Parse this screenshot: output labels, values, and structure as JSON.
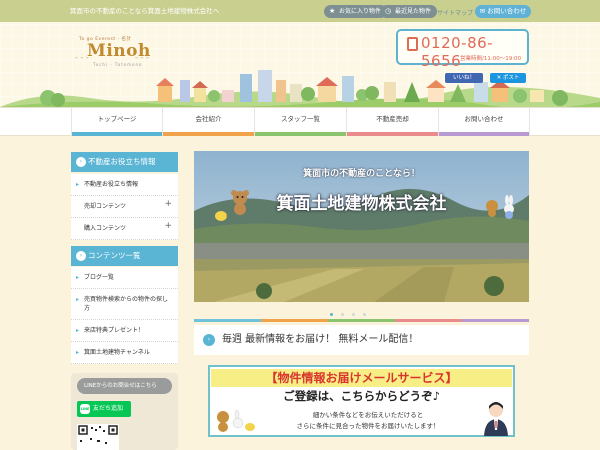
{
  "header": {
    "tagline": "箕面市の不動産のことなら箕面土地建物株式会社へ",
    "favorites_label": "お気に入り物件",
    "history_label": "最近見た物件",
    "sitemap_label": "サイトマップ",
    "contact_label": "お問い合わせ",
    "phone_number": "0120-86-5656",
    "business_hours": "営業時間/11:00～19:00",
    "like_label": "いいね！",
    "post_label": "ポスト"
  },
  "logo": {
    "small": "To go Everest · 名計",
    "main": "Minoh",
    "sub": "Tochi · Tatemono"
  },
  "nav": {
    "items": [
      {
        "label": "トップページ",
        "color": "#5ab4d4"
      },
      {
        "label": "会社紹介",
        "color": "#f0a34a"
      },
      {
        "label": "スタッフ一覧",
        "color": "#8cc36e"
      },
      {
        "label": "不動産売却",
        "color": "#e98b8b"
      },
      {
        "label": "お問い合わせ",
        "color": "#b79ad2"
      }
    ]
  },
  "sidebar": {
    "section1_title": "不動産お役立ち情報",
    "section1_items": [
      {
        "label": "不動産お役立ち情報"
      },
      {
        "label": "売却コンテンツ"
      },
      {
        "label": "購入コンテンツ"
      }
    ],
    "section2_title": "コンテンツ一覧",
    "section2_items": [
      {
        "label": "ブログ一覧"
      },
      {
        "label": "売買物件検索からの物件の探し方"
      },
      {
        "label": "来店特典プレゼント！"
      },
      {
        "label": "箕面土地建物チャンネル"
      }
    ],
    "line_text": "LINEからのお問合せはこちら",
    "line_add_label": "友だち追加",
    "line_logo_text": "LINE"
  },
  "hero": {
    "subtitle": "箕面市の不動産のことなら！",
    "title": "箕面土地建物株式会社"
  },
  "news": {
    "title": "毎週 最新情報をお届け！ 無料メール配信！"
  },
  "banner": {
    "title": "【物件情報お届けメールサービス】",
    "subtitle": "ご登録は、こちらからどうぞ♪",
    "line1": "細かい条件などをお伝えいただけると",
    "line2": "さらに条件に見合った物件をお届けいたします！"
  },
  "colors": {
    "accent": "#5ab4d4",
    "topbar": "#c9cf8f",
    "phone": "#e06a58",
    "banner_title": "#d9352f",
    "line_green": "#06c755"
  }
}
